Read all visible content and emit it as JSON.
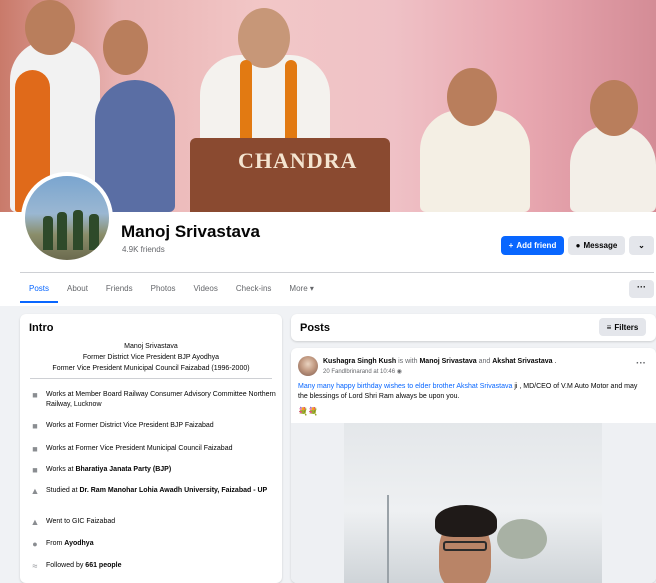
{
  "cover": {
    "podium_text": "CHANDRA"
  },
  "profile": {
    "name": "Manoj Srivastava",
    "friends": "4.9K friends",
    "add_friend_label": "Add friend",
    "message_label": "Message"
  },
  "tabs": [
    {
      "label": "Posts"
    },
    {
      "label": "About"
    },
    {
      "label": "Friends"
    },
    {
      "label": "Photos"
    },
    {
      "label": "Videos"
    },
    {
      "label": "Check-ins"
    },
    {
      "label": "More"
    }
  ],
  "intro": {
    "title": "Intro",
    "bio": [
      "Manoj Srivastava",
      "Former District Vice President BJP Ayodhya",
      "Former Vice President Municipal Council Faizabad (1996-2000)"
    ],
    "items": [
      {
        "icon": "briefcase-icon",
        "text": "Works at Member Board Railway Consumer Advisory Committee Northern Railway, Lucknow"
      },
      {
        "icon": "briefcase-icon",
        "text": "Works at Former District Vice President BJP Faizabad"
      },
      {
        "icon": "briefcase-icon",
        "text": "Works at Former Vice President Municipal Council Faizabad"
      },
      {
        "icon": "briefcase-icon",
        "prefix": "Works at ",
        "bold": "Bharatiya Janata Party (BJP)"
      },
      {
        "icon": "graduation-cap-icon",
        "prefix": "Studied at ",
        "bold": "Dr. Ram Manohar Lohia Awadh University, Faizabad - UP"
      },
      {
        "icon": "graduation-cap-icon",
        "text": "Went to GIC Faizabad"
      },
      {
        "icon": "location-pin-icon",
        "prefix": "From ",
        "bold": "Ayodhya"
      },
      {
        "icon": "rss-icon",
        "prefix": "Followed by ",
        "bold": "661 people"
      }
    ]
  },
  "posts": {
    "title": "Posts",
    "filters_label": "Filters",
    "post": {
      "author": "Kushagra Singh Kush",
      "with_text": " is with ",
      "tag1": "Manoj Srivastava",
      "and_text": " and ",
      "tag2": "Akshat Srivastava",
      "end_text": " .",
      "time": "20 Fandlbrinarand at 10:46",
      "link_text": "Many many happy birthday wishes to elder brother Akshat Srivastava",
      "body_text": " ji , MD/CEO of V.M Auto Motor and may the blessings of Lord Shri Ram always be upon you.",
      "emoji": "💐💐"
    }
  },
  "colors": {
    "accent": "#0866ff",
    "secondary_bg": "#e4e6eb",
    "muted_text": "#65676b"
  }
}
